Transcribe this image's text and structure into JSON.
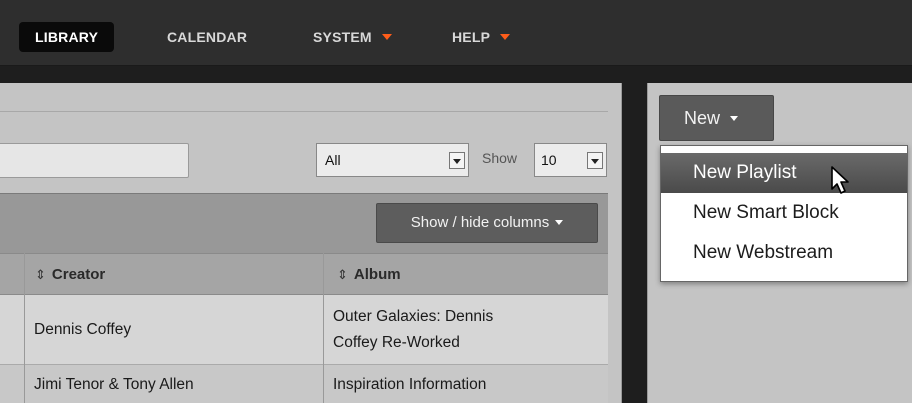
{
  "topnav": {
    "items": [
      {
        "label": "LIBRARY",
        "active": true
      },
      {
        "label": "CALENDAR",
        "active": false
      },
      {
        "label": "SYSTEM",
        "active": false,
        "has_dropdown": true
      },
      {
        "label": "HELP",
        "active": false,
        "has_dropdown": true
      }
    ]
  },
  "library": {
    "search": {
      "value": "",
      "placeholder": ""
    },
    "filter_select": {
      "selected": "All"
    },
    "show_label": "Show",
    "show_select": {
      "selected": "10"
    },
    "show_hide_columns_label": "Show / hide columns",
    "columns": [
      {
        "label": "Creator",
        "icon": "sort-icon"
      },
      {
        "label": "Album",
        "icon": "sort-icon"
      }
    ],
    "rows": [
      {
        "creator": "Dennis Coffey",
        "album_line1": "Outer Galaxies: Dennis",
        "album_line2": "Coffey Re-Worked"
      },
      {
        "creator": "Jimi Tenor & Tony Allen",
        "album_line1": "Inspiration Information",
        "album_line2": ""
      }
    ]
  },
  "new_menu": {
    "button_label": "New",
    "items": [
      {
        "label": "New Playlist",
        "hovered": true
      },
      {
        "label": "New Smart Block",
        "hovered": false
      },
      {
        "label": "New Webstream",
        "hovered": false
      }
    ]
  },
  "colors": {
    "accent": "#ff5d1a",
    "nav_bg": "#2e2e2e",
    "panel_bg": "#c4c4c4",
    "button_bg": "#5a5a5a"
  }
}
